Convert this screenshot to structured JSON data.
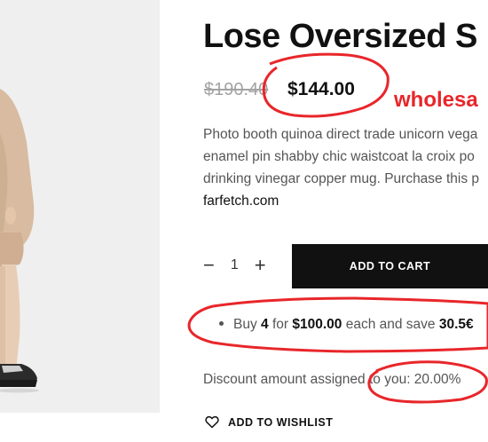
{
  "product": {
    "title": "Lose Oversized S",
    "price_old": "$190.40",
    "price_new": "$144.00",
    "description_lines": [
      "Photo booth quinoa direct trade unicorn vega",
      "enamel pin shabby chic waistcoat la croix po",
      "drinking vinegar copper mug. Purchase this p"
    ],
    "description_link": "farfetch.com"
  },
  "annotation": {
    "text": "wholesa",
    "color": "#e8262a"
  },
  "cart": {
    "minus_label": "−",
    "quantity": "1",
    "plus_label": "+",
    "add_to_cart_label": "ADD TO CART"
  },
  "offer": {
    "prefix": "Buy",
    "qty": "4",
    "for_text": "for",
    "price": "$100.00",
    "suffix": "each and save",
    "save": "30.5€"
  },
  "discount": {
    "text": "Discount amount assigned to you: 20.00%"
  },
  "wishlist": {
    "label": "ADD TO WISHLIST",
    "icon": "heart-icon"
  },
  "colors": {
    "accent_red": "#e8262a",
    "button_black": "#111111"
  }
}
